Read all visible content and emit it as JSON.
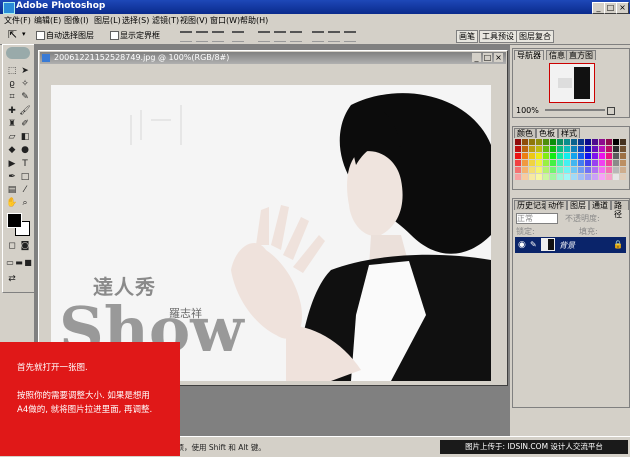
{
  "window": {
    "title": "Adobe Photoshop"
  },
  "menu": [
    "文件(F)",
    "编辑(E)",
    "图像(I)",
    "图层(L)",
    "选择(S)",
    "滤镜(T)",
    "视图(V)",
    "窗口(W)",
    "帮助(H)"
  ],
  "options": {
    "auto_select_layer": "自动选择图层",
    "show_bounding_box": "显示定界框"
  },
  "palette_well_tabs": [
    "画笔",
    "工具预设",
    "图层复合"
  ],
  "document": {
    "title": "20061221152528749.jpg @ 100%(RGB/8#)"
  },
  "artwork": {
    "cn_title": "達人秀",
    "cn_name": "羅志祥",
    "en_name": "Show"
  },
  "navigator": {
    "tabs": [
      "导航器",
      "信息",
      "直方图"
    ],
    "zoom": "100%"
  },
  "color_panel": {
    "tabs": [
      "颜色",
      "色板",
      "样式"
    ]
  },
  "layers_panel": {
    "tabs": [
      "历史记录",
      "动作",
      "图层",
      "通道",
      "路径"
    ],
    "blend_mode": "正常",
    "opacity_label": "不透明度:",
    "lock_label": "锁定:",
    "fill_label": "填充:",
    "layer_name": "背景"
  },
  "status": {
    "hint": "单击并拖移以移动图层或选区。要用附加选项，使用 Shift 和 Alt 键。"
  },
  "watermark": "图片上传于: IDSIN.COM 设计人交流平台",
  "overlay": {
    "line1": "首先就打开一张图.",
    "line2": "按照你的需要调整大小. 如果是想用",
    "line3": "A4做的, 就将图片拉进里面, 再调整."
  },
  "colors": {
    "titlebar": "#0a2a8c",
    "overlay": "#e01818",
    "chrome": "#d4d0c8"
  }
}
